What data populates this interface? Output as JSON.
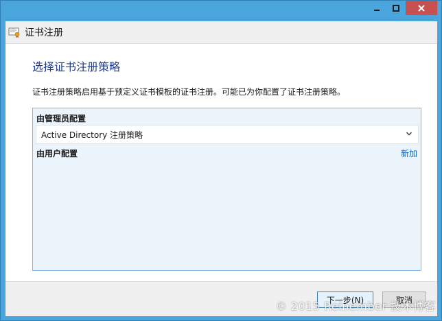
{
  "window": {
    "title": "证书注册",
    "controls": [
      "minimize-icon",
      "maximize-icon",
      "close-icon"
    ]
  },
  "page": {
    "heading": "选择证书注册策略",
    "description": "证书注册策略启用基于预定义证书模板的证书注册。可能已为你配置了证书注册策略。"
  },
  "admin_section": {
    "label": "由管理员配置",
    "policy": "Active Directory 注册策略"
  },
  "user_section": {
    "label": "由用户配置",
    "add_link": "新加"
  },
  "buttons": {
    "next": "下一步(N)",
    "cancel": "取消"
  },
  "watermark": "© 2015 Reinember 技术博客",
  "colors": {
    "frame": "#4aa5dd",
    "heading": "#1e3c8c",
    "panel_bg": "#ebf3fb",
    "panel_border": "#7eb4ea",
    "link": "#0066cc",
    "close_button": "#c75050"
  }
}
